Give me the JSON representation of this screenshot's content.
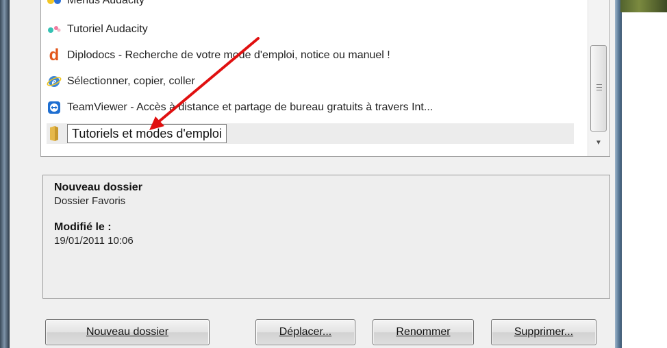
{
  "favorites_list": {
    "items": [
      {
        "label": "Menus Audacity",
        "icon": "audacity-icon",
        "partial": true
      },
      {
        "label": "Tutoriel Audacity",
        "icon": "audacity-icon"
      },
      {
        "label": "Diplodocs - Recherche de votre mode d'emploi, notice ou manuel !",
        "icon": "diplodocs-icon"
      },
      {
        "label": "Sélectionner, copier, coller",
        "icon": "ie-icon"
      },
      {
        "label": "TeamViewer - Accès à distance et partage de bureau gratuits à travers Int...",
        "icon": "teamviewer-icon"
      },
      {
        "label": "Tutoriels et modes d'emploi",
        "icon": "folder-icon",
        "selected": true,
        "editing": true
      }
    ]
  },
  "properties": {
    "name": "Nouveau dossier",
    "type": "Dossier Favoris",
    "modified_label": "Modifié le :",
    "modified_value": "19/01/2011 10:06"
  },
  "buttons": {
    "new_folder": "Nouveau dossier",
    "move": "Déplacer...",
    "rename": "Renommer",
    "delete": "Supprimer..."
  },
  "annotation": {
    "arrow_color": "#e01010"
  },
  "colors": {
    "dialog_bg": "#f0f0f0",
    "selection_bg": "#ececec"
  }
}
